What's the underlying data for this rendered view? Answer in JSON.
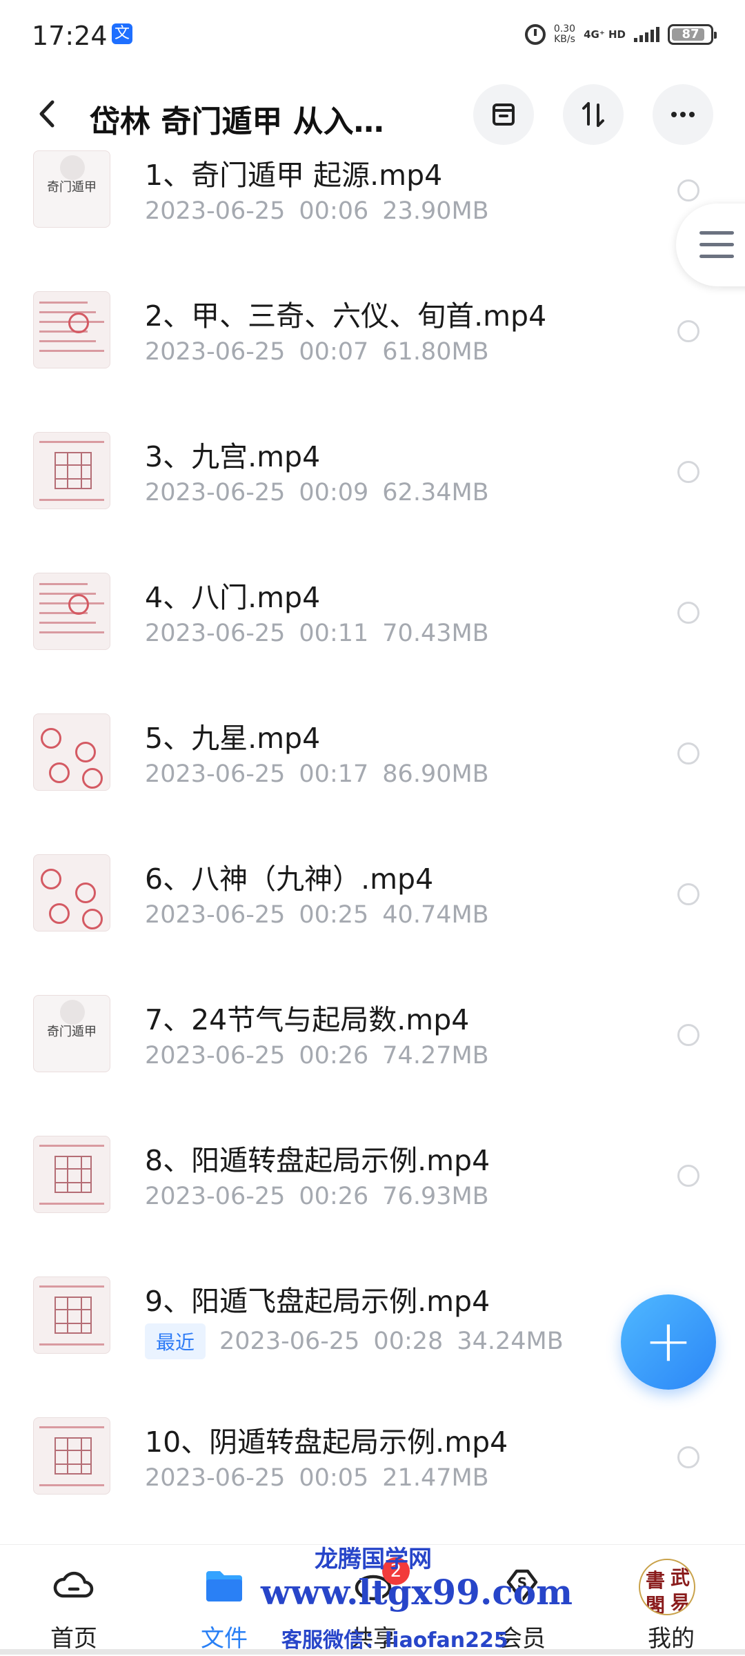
{
  "status_bar": {
    "time": "17:24",
    "app_icon": "文",
    "speed": "0.30",
    "speed_unit": "KB/s",
    "network": "4G⁺ HD",
    "battery": "87",
    "battery_level": 0.87
  },
  "header": {
    "title": "岱林 奇门遁甲 从入…",
    "icons": [
      "back-arrow-icon",
      "archive-box-icon",
      "sort-icon",
      "more-icon"
    ]
  },
  "files": [
    {
      "name": "1、奇门遁甲 起源.mp4",
      "date": "2023-06-25",
      "duration": "00:06",
      "size": "23.90MB",
      "badge": "",
      "cover": "奇门遁甲",
      "thumb": "cover"
    },
    {
      "name": "2、甲、三奇、六仪、旬首.mp4",
      "date": "2023-06-25",
      "duration": "00:07",
      "size": "61.80MB",
      "badge": "",
      "cover": "",
      "thumb": "notes"
    },
    {
      "name": "3、九宫.mp4",
      "date": "2023-06-25",
      "duration": "00:09",
      "size": "62.34MB",
      "badge": "",
      "cover": "",
      "thumb": "grid"
    },
    {
      "name": "4、八门.mp4",
      "date": "2023-06-25",
      "duration": "00:11",
      "size": "70.43MB",
      "badge": "",
      "cover": "",
      "thumb": "notes"
    },
    {
      "name": "5、九星.mp4",
      "date": "2023-06-25",
      "duration": "00:17",
      "size": "86.90MB",
      "badge": "",
      "cover": "",
      "thumb": "circles"
    },
    {
      "name": "6、八神（九神）.mp4",
      "date": "2023-06-25",
      "duration": "00:25",
      "size": "40.74MB",
      "badge": "",
      "cover": "",
      "thumb": "circles"
    },
    {
      "name": "7、24节气与起局数.mp4",
      "date": "2023-06-25",
      "duration": "00:26",
      "size": "74.27MB",
      "badge": "",
      "cover": "奇门遁甲",
      "thumb": "cover"
    },
    {
      "name": "8、阳遁转盘起局示例.mp4",
      "date": "2023-06-25",
      "duration": "00:26",
      "size": "76.93MB",
      "badge": "",
      "cover": "",
      "thumb": "grid"
    },
    {
      "name": "9、阳遁飞盘起局示例.mp4",
      "date": "2023-06-25",
      "duration": "00:28",
      "size": "34.24MB",
      "badge": "最近",
      "cover": "",
      "thumb": "grid"
    },
    {
      "name": "10、阴遁转盘起局示例.mp4",
      "date": "2023-06-25",
      "duration": "00:05",
      "size": "21.47MB",
      "badge": "",
      "cover": "",
      "thumb": "grid"
    }
  ],
  "fab": {
    "label": "+"
  },
  "nav": [
    {
      "label": "首页",
      "icon": "cloud-icon",
      "active": false
    },
    {
      "label": "文件",
      "icon": "folder-icon",
      "active": true
    },
    {
      "label": "共享",
      "icon": "share-icon",
      "active": false,
      "badge": "2"
    },
    {
      "label": "会员",
      "icon": "vip-diamond-icon",
      "active": false
    },
    {
      "label": "我的",
      "icon": "avatar",
      "active": false
    }
  ],
  "avatar_text": [
    "書",
    "武",
    "閣",
    "易"
  ],
  "watermark": {
    "line1": "龙腾国学网",
    "line2": "www.ltgx99.com",
    "line3": "客服微信：liaofan225"
  },
  "colors": {
    "accent": "#2a80f5",
    "meta_gray": "#a5a9b0",
    "badge_red": "#f23b3b"
  }
}
